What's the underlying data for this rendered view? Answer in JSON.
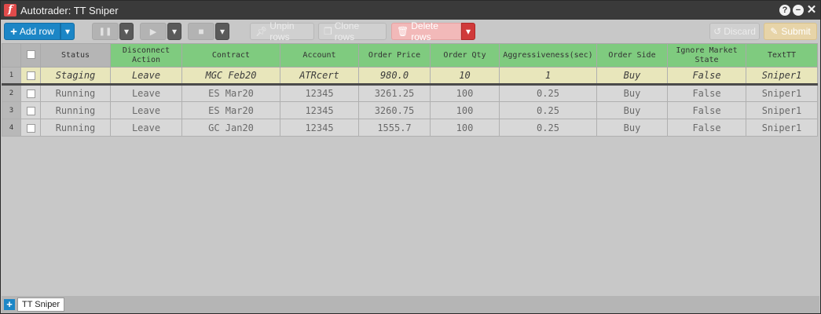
{
  "window": {
    "logo_letter": "f",
    "title": "Autotrader: TT Sniper",
    "help_icon": "?",
    "minimize_icon": "−",
    "close_icon": "✕"
  },
  "toolbar": {
    "add_row_label": "Add row",
    "add_row_plus": "+",
    "pause_icon": "❚❚",
    "play_icon": "▶",
    "stop_icon": "■",
    "dropdown_icon": "▾",
    "unpin_label": "Unpin rows",
    "unpin_icon": "pin-icon",
    "clone_label": "Clone rows",
    "clone_icon": "clone-icon",
    "delete_label": "Delete rows",
    "delete_icon": "trash-icon",
    "discard_label": "Discard",
    "discard_icon": "undo-icon",
    "submit_label": "Submit",
    "submit_icon": "pencil-icon"
  },
  "grid": {
    "columns": [
      {
        "label": "Status",
        "style": "gray"
      },
      {
        "label": "Disconnect Action",
        "style": "green"
      },
      {
        "label": "Contract",
        "style": "green"
      },
      {
        "label": "Account",
        "style": "green"
      },
      {
        "label": "Order Price",
        "style": "green"
      },
      {
        "label": "Order Qty",
        "style": "green"
      },
      {
        "label": "Aggressiveness(sec)",
        "style": "green"
      },
      {
        "label": "Order Side",
        "style": "green"
      },
      {
        "label": "Ignore Market State",
        "style": "green"
      },
      {
        "label": "TextTT",
        "style": "green"
      }
    ],
    "rows": [
      {
        "num": "1",
        "state": "staging",
        "cells": [
          "Staging",
          "Leave",
          "MGC Feb20",
          "ATRcert",
          "980.0",
          "10",
          "1",
          "Buy",
          "False",
          "Sniper1"
        ]
      },
      {
        "num": "2",
        "state": "running",
        "cells": [
          "Running",
          "Leave",
          "ES Mar20",
          "12345",
          "3261.25",
          "100",
          "0.25",
          "Buy",
          "False",
          "Sniper1"
        ]
      },
      {
        "num": "3",
        "state": "running",
        "cells": [
          "Running",
          "Leave",
          "ES Mar20",
          "12345",
          "3260.75",
          "100",
          "0.25",
          "Buy",
          "False",
          "Sniper1"
        ]
      },
      {
        "num": "4",
        "state": "running",
        "cells": [
          "Running",
          "Leave",
          "GC Jan20",
          "12345",
          "1555.7",
          "100",
          "0.25",
          "Buy",
          "False",
          "Sniper1"
        ]
      }
    ]
  },
  "tabs": {
    "add_icon": "+",
    "items": [
      {
        "label": "TT Sniper",
        "active": true
      }
    ]
  },
  "colors": {
    "primary": "#1c86c6",
    "header_green": "#7fcb7f",
    "staging_row": "#e8e6bb",
    "delete_red": "#d03a3a"
  }
}
